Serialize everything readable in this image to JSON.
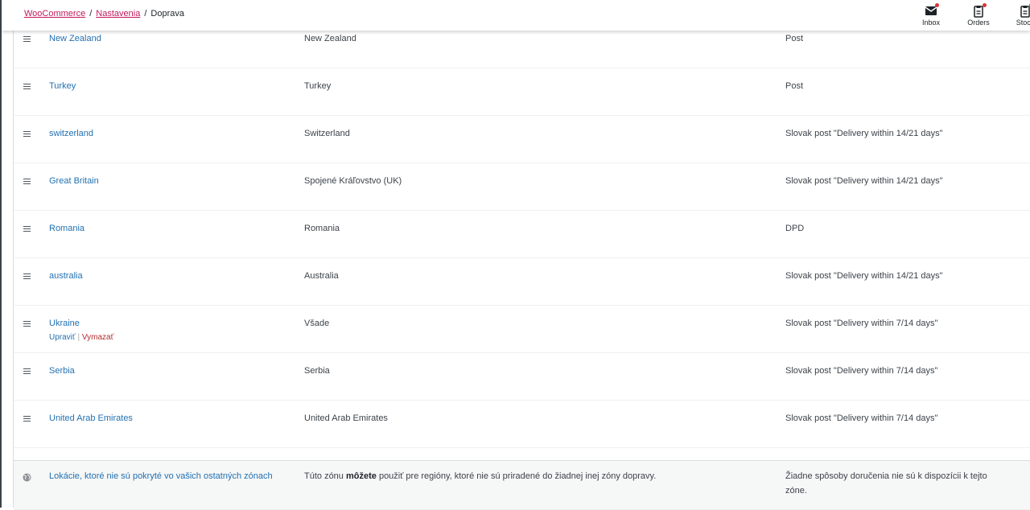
{
  "breadcrumb": {
    "root": "WooCommerce",
    "settings": "Nastavenia",
    "current": "Doprava",
    "separator": "/"
  },
  "header_actions": [
    {
      "label": "Inbox",
      "icon": "inbox-icon"
    },
    {
      "label": "Orders",
      "icon": "orders-icon"
    },
    {
      "label": "Stock",
      "icon": "stock-icon"
    }
  ],
  "zones": [
    {
      "name": "New Zealand",
      "region": "New Zealand",
      "method": "Post"
    },
    {
      "name": "Turkey",
      "region": "Turkey",
      "method": "Post"
    },
    {
      "name": "switzerland",
      "region": "Switzerland",
      "method": "Slovak post \"Delivery within 14/21 days\""
    },
    {
      "name": "Great Britain",
      "region": "Spojené Kráľovstvo (UK)",
      "method": "Slovak post \"Delivery within 14/21 days\""
    },
    {
      "name": "Romania",
      "region": "Romania",
      "method": "DPD"
    },
    {
      "name": "australia",
      "region": "Australia",
      "method": "Slovak post \"Delivery within 14/21 days\""
    },
    {
      "name": "Ukraine",
      "region": "Všade",
      "method": "Slovak post \"Delivery within 7/14 days\""
    },
    {
      "name": "Serbia",
      "region": "Serbia",
      "method": "Slovak post \"Delivery within 7/14 days\""
    },
    {
      "name": "United Arab Emirates",
      "region": "United Arab Emirates",
      "method": "Slovak post \"Delivery within 7/14 days\""
    }
  ],
  "row_actions": {
    "edit": "Upraviť",
    "separator": "|",
    "delete": "Vymazať"
  },
  "rest_of_world": {
    "name": "Lokácie, ktoré nie sú pokryté vo vašich ostatných zónach",
    "region_before": "Túto zónu ",
    "region_bold": "môžete",
    "region_after": " použiť pre regióny, ktoré nie sú priradené do žiadnej inej zóny dopravy.",
    "method": "Žiadne spôsoby doručenia nie sú k dispozícii k tejto zóne."
  },
  "colors": {
    "link": "#2271b1",
    "breadcrumb_link": "#c2185b",
    "delete": "#b32d2e",
    "notification_dot": "#d63638"
  }
}
